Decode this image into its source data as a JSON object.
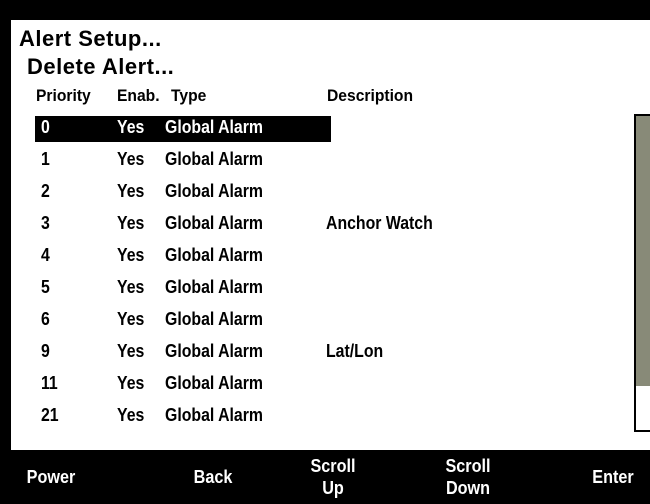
{
  "screen": {
    "title": "Alert Setup...",
    "subtitle": "Delete Alert..."
  },
  "columns": {
    "priority": "Priority",
    "enabled": "Enab.",
    "type": "Type",
    "description": "Description"
  },
  "rows": [
    {
      "priority": "0",
      "enabled": "Yes",
      "type": "Global Alarm",
      "description": "",
      "selected": true
    },
    {
      "priority": "1",
      "enabled": "Yes",
      "type": "Global Alarm",
      "description": ""
    },
    {
      "priority": "2",
      "enabled": "Yes",
      "type": "Global Alarm",
      "description": ""
    },
    {
      "priority": "3",
      "enabled": "Yes",
      "type": "Global Alarm",
      "description": "Anchor Watch"
    },
    {
      "priority": "4",
      "enabled": "Yes",
      "type": "Global Alarm",
      "description": ""
    },
    {
      "priority": "5",
      "enabled": "Yes",
      "type": "Global Alarm",
      "description": ""
    },
    {
      "priority": "6",
      "enabled": "Yes",
      "type": "Global Alarm",
      "description": ""
    },
    {
      "priority": "9",
      "enabled": "Yes",
      "type": "Global Alarm",
      "description": "Lat/Lon"
    },
    {
      "priority": "11",
      "enabled": "Yes",
      "type": "Global Alarm",
      "description": ""
    },
    {
      "priority": "21",
      "enabled": "Yes",
      "type": "Global Alarm",
      "description": ""
    }
  ],
  "scrollbar": {
    "visible_fraction": 0.86
  },
  "softkeys": {
    "power": "Power",
    "back": "Back",
    "scroll_up_1": "Scroll",
    "scroll_up_2": "Up",
    "scroll_down_1": "Scroll",
    "scroll_down_2": "Down",
    "enter": "Enter"
  },
  "colors": {
    "background": "#000000",
    "screen": "#ffffff",
    "scroll_thumb": "#888a78"
  }
}
